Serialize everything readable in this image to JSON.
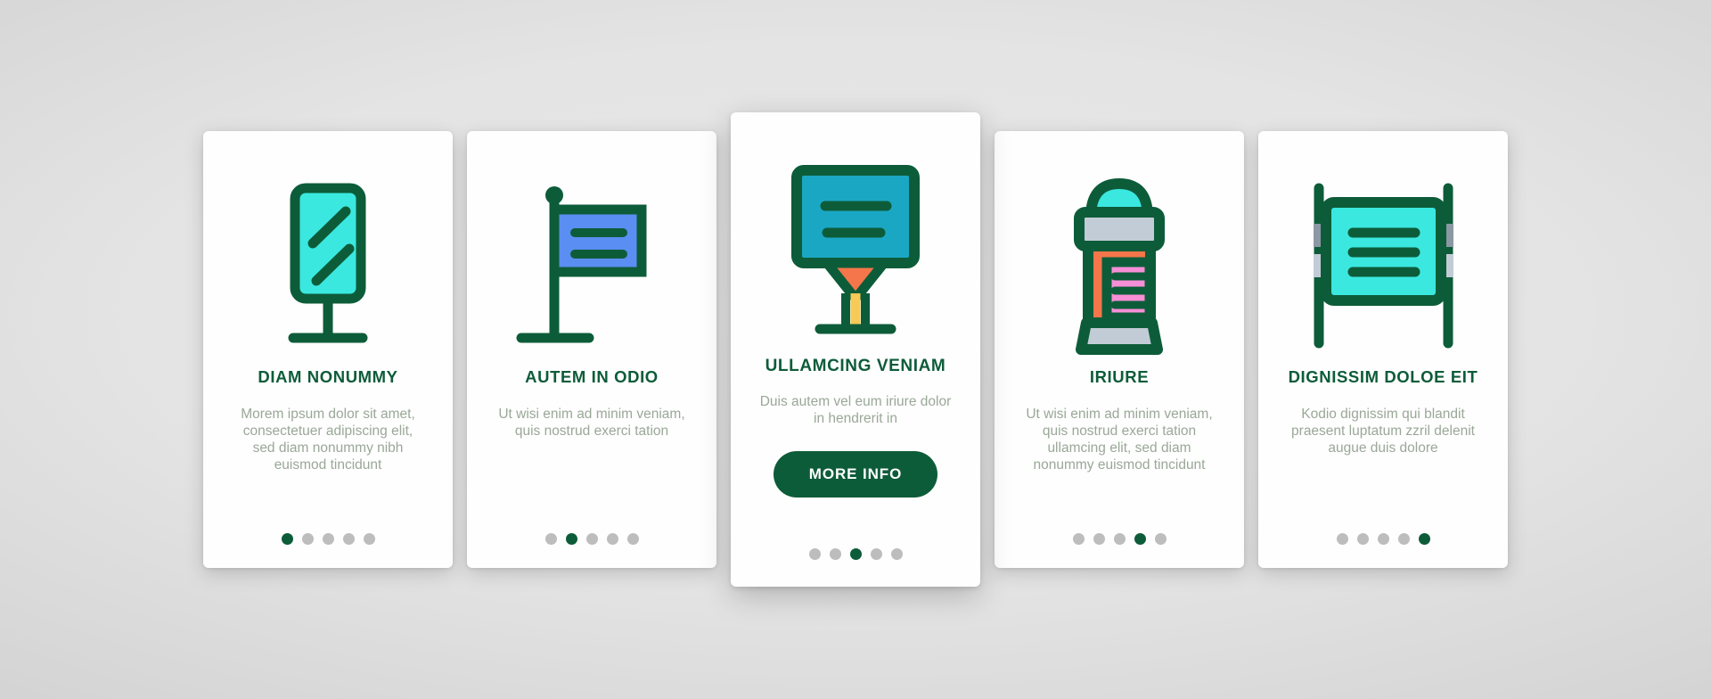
{
  "theme": {
    "background": "#d9d9d9",
    "card_background": "#fefefe",
    "accent_green": "#0d5c39",
    "body_text": "#9aa898",
    "dot_inactive": "#bdbdbd",
    "dot_active": "#0d5c39",
    "icon_cyan": "#3ae8e0",
    "icon_blue": "#5b8ef2",
    "icon_teal": "#1aa7c4",
    "icon_orange": "#f4764a",
    "icon_pink": "#f78fd6",
    "icon_gray": "#c2ccd6",
    "icon_yellow": "#f7c955"
  },
  "cards": [
    {
      "id": "card-diam-nonummy",
      "icon": "mirror-billboard-icon",
      "title": "DIAM NONUMMY",
      "body": "Morem ipsum dolor sit amet, consectetuer adipiscing elit, sed diam nonummy nibh euismod tincidunt",
      "featured": false,
      "dots": {
        "count": 5,
        "active_index": 0
      }
    },
    {
      "id": "card-autem-in-odio",
      "icon": "flag-sign-icon",
      "title": "AUTEM IN ODIO",
      "body": "Ut wisi enim ad minim veniam, quis nostrud exerci tation",
      "featured": false,
      "dots": {
        "count": 5,
        "active_index": 1
      }
    },
    {
      "id": "card-ullamcing-veniam",
      "icon": "billboard-stand-icon",
      "title": "ULLAMCING VENIAM",
      "body": "Duis autem vel eum iriure dolor in hendrerit in",
      "button_label": "MORE INFO",
      "featured": true,
      "dots": {
        "count": 5,
        "active_index": 2
      }
    },
    {
      "id": "card-iriure",
      "icon": "advertising-column-icon",
      "title": "IRIURE",
      "body": "Ut wisi enim ad minim veniam, quis nostrud exerci tation ullamcing elit, sed diam nonummy euismod tincidunt",
      "featured": false,
      "dots": {
        "count": 5,
        "active_index": 3
      }
    },
    {
      "id": "card-dignissim-doloe-eit",
      "icon": "hanging-sign-icon",
      "title": "DIGNISSIM DOLOE EIT",
      "body": "Kodio dignissim qui blandit praesent luptatum zzril delenit augue duis dolore",
      "featured": false,
      "dots": {
        "count": 5,
        "active_index": 4
      }
    }
  ]
}
